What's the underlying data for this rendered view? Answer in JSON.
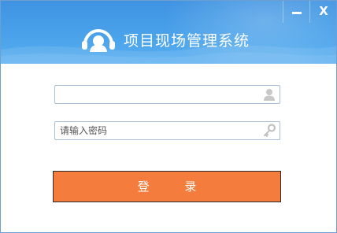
{
  "window": {
    "title": "项目现场管理系统",
    "minimize_label": "",
    "close_label": "X"
  },
  "login": {
    "username_value": "",
    "username_placeholder": "",
    "password_value": "",
    "password_placeholder": "请输入密码",
    "submit_label": "登 录"
  },
  "icons": {
    "logo": "headset-logo-icon",
    "username": "user-icon",
    "password": "key-icon",
    "minimize": "minimize-icon",
    "close": "close-icon"
  },
  "colors": {
    "header": "#4aa2ea",
    "button": "#f47c3c",
    "field_border": "#a9c0d6"
  }
}
